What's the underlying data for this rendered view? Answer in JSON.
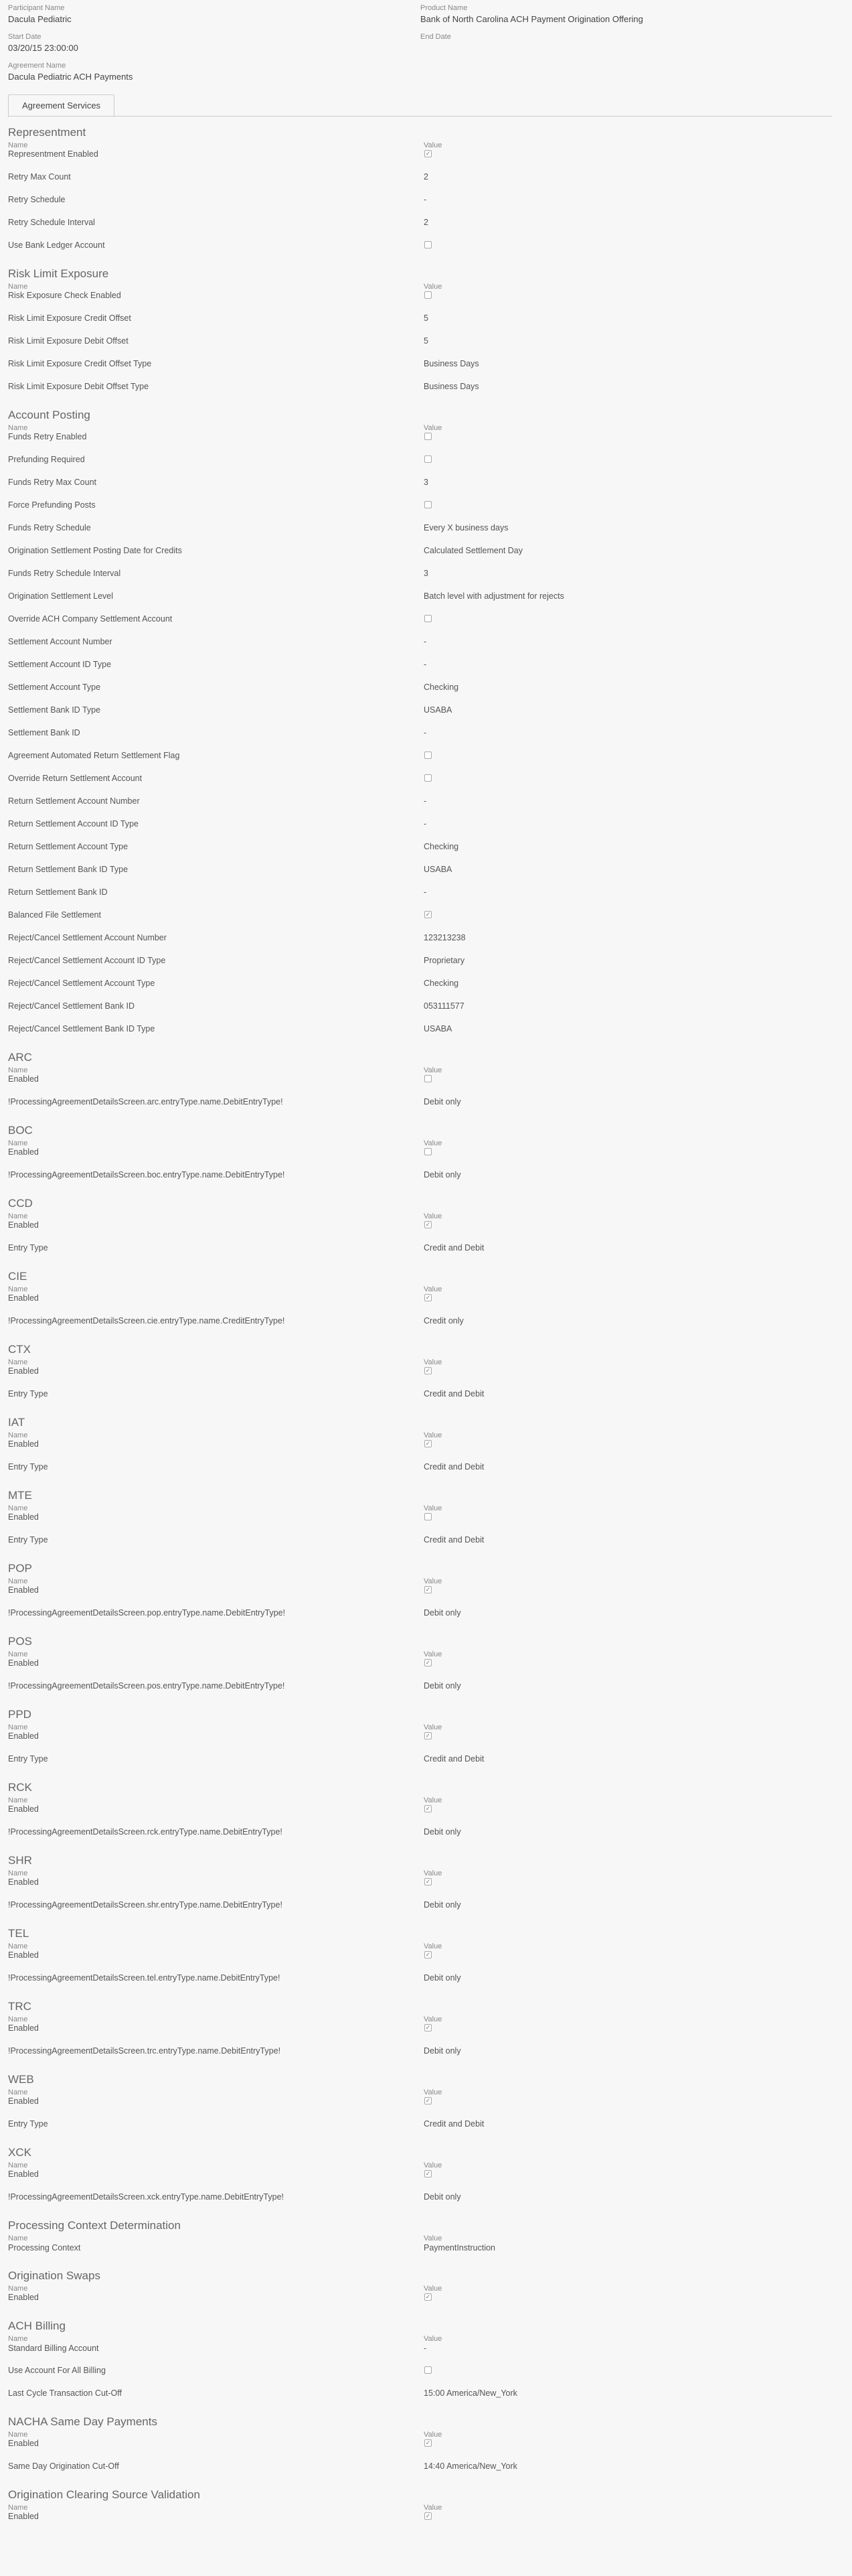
{
  "header": {
    "participant_name_label": "Participant Name",
    "participant_name": "Dacula Pediatric",
    "product_name_label": "Product Name",
    "product_name": "Bank of North Carolina ACH Payment Origination Offering",
    "start_date_label": "Start Date",
    "start_date": "03/20/15 23:00:00",
    "end_date_label": "End Date",
    "agreement_name_label": "Agreement Name",
    "agreement_name": "Dacula Pediatric ACH Payments"
  },
  "tabs": [
    "Agreement Services"
  ],
  "column_labels": {
    "name": "Name",
    "value": "Value"
  },
  "sections": [
    {
      "title": "Representment",
      "rows": [
        {
          "name": "Representment Enabled",
          "checked": true
        },
        {
          "name": "Retry Max Count",
          "value": "2"
        },
        {
          "name": "Retry Schedule",
          "value": "-"
        },
        {
          "name": "Retry Schedule Interval",
          "value": "2"
        },
        {
          "name": "Use Bank Ledger Account",
          "checked": false
        }
      ]
    },
    {
      "title": "Risk Limit Exposure",
      "rows": [
        {
          "name": "Risk Exposure Check Enabled",
          "checked": false
        },
        {
          "name": "Risk Limit Exposure Credit Offset",
          "value": "5"
        },
        {
          "name": "Risk Limit Exposure Debit Offset",
          "value": "5"
        },
        {
          "name": "Risk Limit Exposure Credit Offset Type",
          "value": "Business Days"
        },
        {
          "name": "Risk Limit Exposure Debit Offset Type",
          "value": "Business Days"
        }
      ]
    },
    {
      "title": "Account Posting",
      "rows": [
        {
          "name": "Funds Retry Enabled",
          "checked": false
        },
        {
          "name": "Prefunding Required",
          "checked": false
        },
        {
          "name": "Funds Retry Max Count",
          "value": "3"
        },
        {
          "name": "Force Prefunding Posts",
          "checked": false
        },
        {
          "name": "Funds Retry Schedule",
          "value": "Every X business days"
        },
        {
          "name": "Origination Settlement Posting Date for Credits",
          "value": "Calculated Settlement Day"
        },
        {
          "name": "Funds Retry Schedule Interval",
          "value": "3"
        },
        {
          "name": "Origination Settlement Level",
          "value": "Batch level with adjustment for rejects"
        },
        {
          "name": "Override ACH Company Settlement Account",
          "checked": false
        },
        {
          "name": "Settlement Account Number",
          "value": "-"
        },
        {
          "name": "Settlement Account ID Type",
          "value": "-"
        },
        {
          "name": "Settlement Account Type",
          "value": "Checking"
        },
        {
          "name": "Settlement Bank ID Type",
          "value": "USABA"
        },
        {
          "name": "Settlement Bank ID",
          "value": "-"
        },
        {
          "name": "Agreement Automated Return Settlement Flag",
          "checked": false
        },
        {
          "name": "Override Return Settlement Account",
          "checked": false
        },
        {
          "name": "Return Settlement Account Number",
          "value": "-"
        },
        {
          "name": "Return Settlement Account ID Type",
          "value": "-"
        },
        {
          "name": "Return Settlement Account Type",
          "value": "Checking"
        },
        {
          "name": "Return Settlement Bank ID Type",
          "value": "USABA"
        },
        {
          "name": "Return Settlement Bank ID",
          "value": "-"
        },
        {
          "name": "Balanced File Settlement",
          "checked": true
        },
        {
          "name": "Reject/Cancel Settlement Account Number",
          "value": "123213238"
        },
        {
          "name": "Reject/Cancel Settlement Account ID Type",
          "value": "Proprietary"
        },
        {
          "name": "Reject/Cancel Settlement Account Type",
          "value": "Checking"
        },
        {
          "name": "Reject/Cancel Settlement Bank ID",
          "value": "053111577"
        },
        {
          "name": "Reject/Cancel Settlement Bank ID Type",
          "value": "USABA"
        }
      ]
    },
    {
      "title": "ARC",
      "rows": [
        {
          "name": "Enabled",
          "checked": false
        },
        {
          "name": "!ProcessingAgreementDetailsScreen.arc.entryType.name.DebitEntryType!",
          "value": "Debit only"
        }
      ]
    },
    {
      "title": "BOC",
      "rows": [
        {
          "name": "Enabled",
          "checked": false
        },
        {
          "name": "!ProcessingAgreementDetailsScreen.boc.entryType.name.DebitEntryType!",
          "value": "Debit only"
        }
      ]
    },
    {
      "title": "CCD",
      "rows": [
        {
          "name": "Enabled",
          "checked": true
        },
        {
          "name": "Entry Type",
          "value": "Credit and Debit"
        }
      ]
    },
    {
      "title": "CIE",
      "rows": [
        {
          "name": "Enabled",
          "checked": true
        },
        {
          "name": "!ProcessingAgreementDetailsScreen.cie.entryType.name.CreditEntryType!",
          "value": "Credit only"
        }
      ]
    },
    {
      "title": "CTX",
      "rows": [
        {
          "name": "Enabled",
          "checked": true
        },
        {
          "name": "Entry Type",
          "value": "Credit and Debit"
        }
      ]
    },
    {
      "title": "IAT",
      "rows": [
        {
          "name": "Enabled",
          "checked": true
        },
        {
          "name": "Entry Type",
          "value": "Credit and Debit"
        }
      ]
    },
    {
      "title": "MTE",
      "rows": [
        {
          "name": "Enabled",
          "checked": false
        },
        {
          "name": "Entry Type",
          "value": "Credit and Debit"
        }
      ]
    },
    {
      "title": "POP",
      "rows": [
        {
          "name": "Enabled",
          "checked": true
        },
        {
          "name": "!ProcessingAgreementDetailsScreen.pop.entryType.name.DebitEntryType!",
          "value": "Debit only"
        }
      ]
    },
    {
      "title": "POS",
      "rows": [
        {
          "name": "Enabled",
          "checked": true
        },
        {
          "name": "!ProcessingAgreementDetailsScreen.pos.entryType.name.DebitEntryType!",
          "value": "Debit only"
        }
      ]
    },
    {
      "title": "PPD",
      "rows": [
        {
          "name": "Enabled",
          "checked": true
        },
        {
          "name": "Entry Type",
          "value": "Credit and Debit"
        }
      ]
    },
    {
      "title": "RCK",
      "rows": [
        {
          "name": "Enabled",
          "checked": true
        },
        {
          "name": "!ProcessingAgreementDetailsScreen.rck.entryType.name.DebitEntryType!",
          "value": "Debit only"
        }
      ]
    },
    {
      "title": "SHR",
      "rows": [
        {
          "name": "Enabled",
          "checked": true
        },
        {
          "name": "!ProcessingAgreementDetailsScreen.shr.entryType.name.DebitEntryType!",
          "value": "Debit only"
        }
      ]
    },
    {
      "title": "TEL",
      "rows": [
        {
          "name": "Enabled",
          "checked": true
        },
        {
          "name": "!ProcessingAgreementDetailsScreen.tel.entryType.name.DebitEntryType!",
          "value": "Debit only"
        }
      ]
    },
    {
      "title": "TRC",
      "rows": [
        {
          "name": "Enabled",
          "checked": true
        },
        {
          "name": "!ProcessingAgreementDetailsScreen.trc.entryType.name.DebitEntryType!",
          "value": "Debit only"
        }
      ]
    },
    {
      "title": "WEB",
      "rows": [
        {
          "name": "Enabled",
          "checked": true
        },
        {
          "name": "Entry Type",
          "value": "Credit and Debit"
        }
      ]
    },
    {
      "title": "XCK",
      "rows": [
        {
          "name": "Enabled",
          "checked": true
        },
        {
          "name": "!ProcessingAgreementDetailsScreen.xck.entryType.name.DebitEntryType!",
          "value": "Debit only"
        }
      ]
    },
    {
      "title": "Processing Context Determination",
      "rows": [
        {
          "name": "Processing Context",
          "value": "PaymentInstruction",
          "compact": true
        }
      ]
    },
    {
      "title": "Origination Swaps",
      "rows": [
        {
          "name": "Enabled",
          "checked": true
        }
      ]
    },
    {
      "title": "ACH Billing",
      "rows": [
        {
          "name": "Standard Billing Account",
          "value": "-",
          "compact": true
        },
        {
          "name": "Use Account For All Billing",
          "checked": false
        },
        {
          "name": "Last Cycle Transaction Cut-Off",
          "value": "15:00 America/New_York"
        }
      ]
    },
    {
      "title": "NACHA Same Day Payments",
      "rows": [
        {
          "name": "Enabled",
          "checked": true
        },
        {
          "name": "Same Day Origination Cut-Off",
          "value": "14:40 America/New_York"
        }
      ]
    },
    {
      "title": "Origination Clearing Source Validation",
      "rows": [
        {
          "name": "Enabled",
          "checked": true
        }
      ]
    }
  ]
}
